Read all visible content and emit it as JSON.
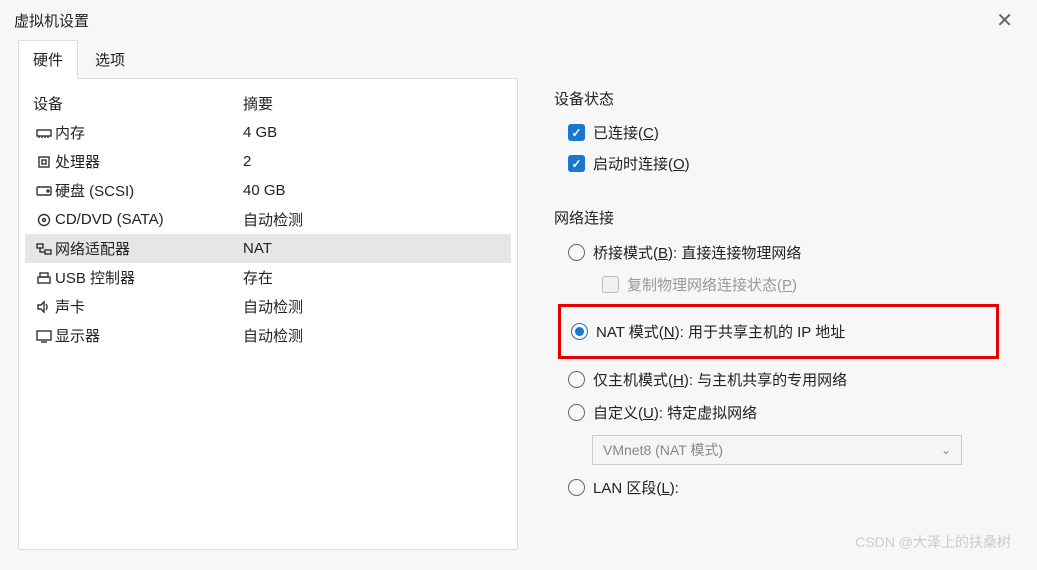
{
  "window": {
    "title": "虚拟机设置"
  },
  "tabs": {
    "hardware": "硬件",
    "options": "选项"
  },
  "device_headers": {
    "device": "设备",
    "summary": "摘要"
  },
  "devices": [
    {
      "icon": "memory",
      "label": "内存",
      "summary": "4 GB",
      "selected": false
    },
    {
      "icon": "cpu",
      "label": "处理器",
      "summary": "2",
      "selected": false
    },
    {
      "icon": "disk",
      "label": "硬盘 (SCSI)",
      "summary": "40 GB",
      "selected": false
    },
    {
      "icon": "cd",
      "label": "CD/DVD (SATA)",
      "summary": "自动检测",
      "selected": false
    },
    {
      "icon": "network",
      "label": "网络适配器",
      "summary": "NAT",
      "selected": true
    },
    {
      "icon": "usb",
      "label": "USB 控制器",
      "summary": "存在",
      "selected": false
    },
    {
      "icon": "sound",
      "label": "声卡",
      "summary": "自动检测",
      "selected": false
    },
    {
      "icon": "display",
      "label": "显示器",
      "summary": "自动检测",
      "selected": false
    }
  ],
  "device_status": {
    "title": "设备状态",
    "connected": {
      "label_pre": "已连接(",
      "ul": "C",
      "label_post": ")",
      "checked": true
    },
    "connect_on_start": {
      "label_pre": "启动时连接(",
      "ul": "O",
      "label_post": ")",
      "checked": true
    }
  },
  "network": {
    "title": "网络连接",
    "bridge": {
      "label_pre": "桥接模式(",
      "ul": "B",
      "label_post": "): 直接连接物理网络",
      "checked": false
    },
    "bridge_copy": {
      "label_pre": "复制物理网络连接状态(",
      "ul": "P",
      "label_post": ")",
      "disabled": true
    },
    "nat": {
      "label_pre": "NAT 模式(",
      "ul": "N",
      "label_post": "): 用于共享主机的 IP 地址",
      "checked": true
    },
    "host_only": {
      "label_pre": "仅主机模式(",
      "ul": "H",
      "label_post": "): 与主机共享的专用网络",
      "checked": false
    },
    "custom": {
      "label_pre": "自定义(",
      "ul": "U",
      "label_post": "): 特定虚拟网络",
      "checked": false
    },
    "custom_select": "VMnet8 (NAT 模式)",
    "lan": {
      "label_pre": "LAN 区段(",
      "ul": "L",
      "label_post": "):",
      "checked": false
    }
  },
  "watermark": "CSDN @大泽上的扶桑树"
}
